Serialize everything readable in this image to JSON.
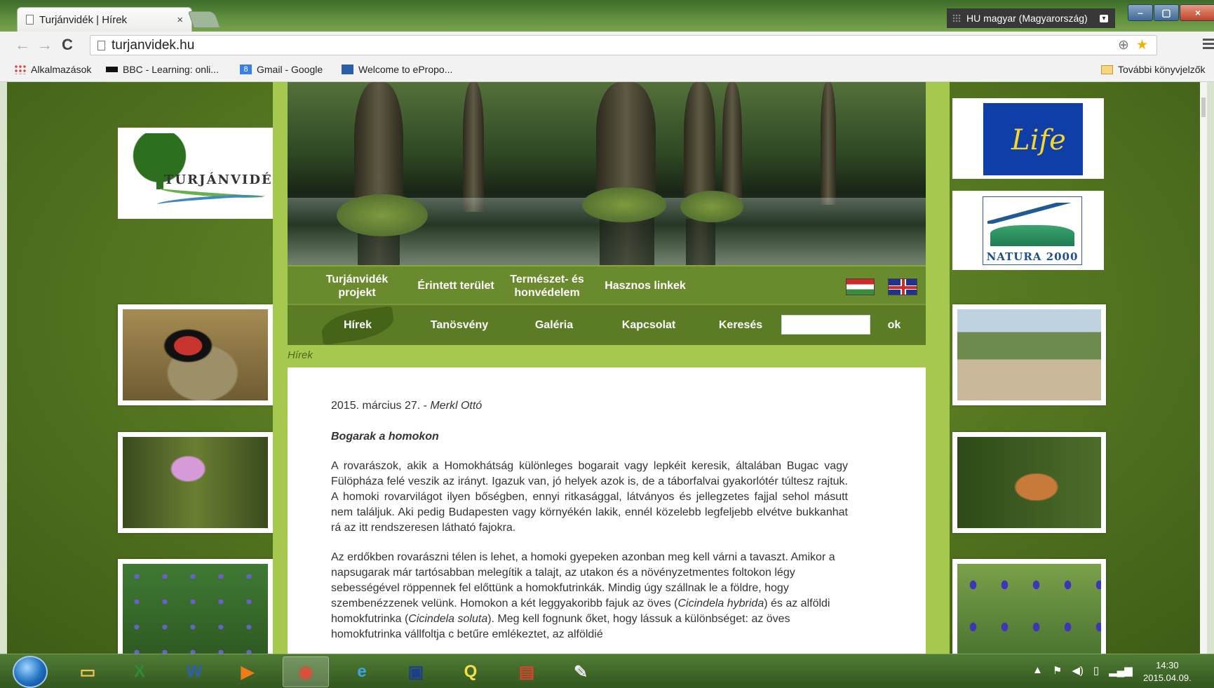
{
  "browser": {
    "tab_title": "Turjánvidék | Hírek",
    "tab_close": "×",
    "language_indicator": "HU magyar (Magyarország)",
    "window_controls": [
      "–",
      "▢",
      "×"
    ],
    "url": "turjanvidek.hu",
    "bookmarks": [
      {
        "label": "Alkalmazások",
        "icon": "apps-grid-icon"
      },
      {
        "label": "BBC - Learning: onli...",
        "icon": "bbc-icon"
      },
      {
        "label": "Gmail - Google",
        "icon": "google-icon"
      },
      {
        "label": "Welcome to ePropo...",
        "icon": "epropo-icon"
      }
    ],
    "other_bookmarks": "További könyvjelzők"
  },
  "site": {
    "logo_text": "TURJÁNVIDÉK",
    "nav_top": [
      {
        "label": "Turjánvidék\nprojekt"
      },
      {
        "label": "Érintett terület"
      },
      {
        "label": "Természet- és\nhonvédelem"
      },
      {
        "label": "Hasznos linkek"
      }
    ],
    "nav_bottom": [
      {
        "label": "Hírek"
      },
      {
        "label": "Tanösvény"
      },
      {
        "label": "Galéria"
      },
      {
        "label": "Kapcsolat"
      }
    ],
    "search_label": "Keresés",
    "search_button": "ok",
    "breadcrumb": "Hírek",
    "eu_logo_text": "Life",
    "natura_text": "NATURA 2000"
  },
  "article": {
    "date": "2015. március 27. - ",
    "author": "Merkl Ottó",
    "title": "Bogarak a homokon",
    "para1": "A rovarászok, akik a Homokhátság különleges bogarait vagy lepkéit keresik, általában Bugac vagy Fülöpháza felé veszik az irányt. Igazuk van, jó helyek azok is, de a táborfalvai gyakorlótér túltesz rajtuk. A homoki rovarvilágot ilyen bőségben, ennyi ritkasággal, látványos és jellegzetes fajjal sehol másutt nem találjuk. Aki pedig Budapesten vagy környékén lakik, ennél közelebb legfeljebb elvétve bukkanhat rá az itt rendszeresen látható fajokra.",
    "para2_a": "Az erdőkben rovarászni télen is lehet, a homoki gyepeken azonban meg kell várni a tavaszt. Amikor a napsugarak már tartósabban melegítik a talajt, az utakon és a növényzetmentes foltokon légy sebességével röppennek fel előttünk a homokfutrinkák. Mindig úgy szállnak le a földre, hogy szembenézzenek velünk. Homokon a két leggyakoribb fajuk az öves (",
    "para2_i1": "Cicindela hybrida",
    "para2_b": ") és az alföldi homokfutrinka (",
    "para2_i2": "Cicindela soluta",
    "para2_c": "). Meg kell fognunk őket, hogy lássuk a különbséget: az öves homokfutrinka vállfoltja c betűre emlékeztet, az alföldié"
  },
  "taskbar": {
    "time": "14:30",
    "date": "2015.04.09."
  },
  "colors": {
    "page_bg": "#587a22",
    "center_bg": "#a6c84e",
    "nav_bg": "#6a8b2d",
    "link_green": "#4c6a1e"
  }
}
